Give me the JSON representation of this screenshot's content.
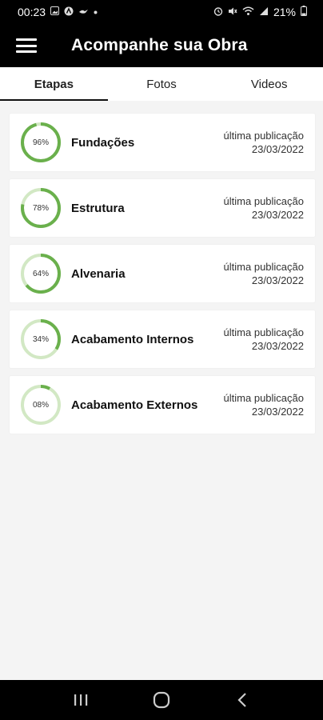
{
  "status_bar": {
    "time": "00:23",
    "battery": "21%",
    "left_icons": [
      "gallery-icon",
      "a-circle-icon",
      "bird-icon",
      "dot-icon"
    ],
    "right_icons": [
      "alarm-icon",
      "mute-icon",
      "wifi-icon",
      "signal-icon",
      "battery-icon"
    ]
  },
  "header": {
    "title": "Acompanhe sua Obra",
    "menu_icon": "hamburger-menu-icon"
  },
  "tabs": [
    {
      "label": "Etapas",
      "active": true
    },
    {
      "label": "Fotos",
      "active": false
    },
    {
      "label": "Videos",
      "active": false
    }
  ],
  "stages": [
    {
      "name": "Fundações",
      "percent_label": "96%",
      "progress": 0.96,
      "meta_label": "última publicação",
      "date": "23/03/2022"
    },
    {
      "name": "Estrutura",
      "percent_label": "78%",
      "progress": 0.78,
      "meta_label": "última publicação",
      "date": "23/03/2022"
    },
    {
      "name": "Alvenaria",
      "percent_label": "64%",
      "progress": 0.64,
      "meta_label": "última publicação",
      "date": "23/03/2022"
    },
    {
      "name": "Acabamento Internos",
      "percent_label": "34%",
      "progress": 0.34,
      "meta_label": "última publicação",
      "date": "23/03/2022"
    },
    {
      "name": "Acabamento Externos",
      "percent_label": "08%",
      "progress": 0.08,
      "meta_label": "última publicação",
      "date": "23/03/2022"
    }
  ],
  "colors": {
    "progress": "#6ab04c",
    "track": "#d2e8c4",
    "bars": "#000000"
  },
  "nav_bar": {
    "icons": [
      "recent-apps-icon",
      "home-icon",
      "back-icon"
    ]
  }
}
